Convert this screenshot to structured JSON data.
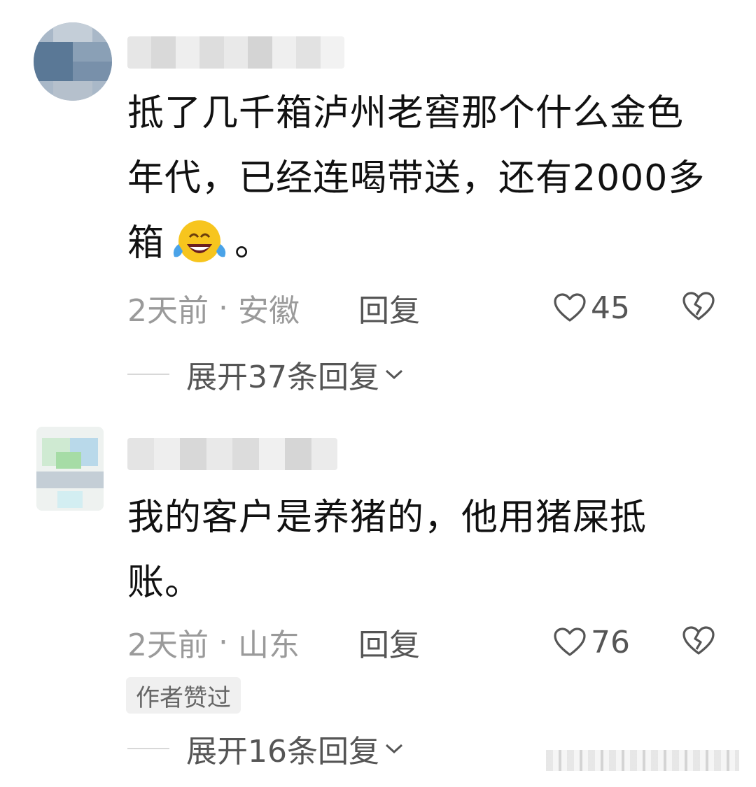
{
  "comments": [
    {
      "text_before_emoji": "抵了几千箱泸州老窖那个什么金色年代，已经连喝带送，还有2000多箱",
      "emoji": "laughing-tears-emoji",
      "text_after_emoji": "。",
      "time": "2天前",
      "location": "安徽",
      "reply_label": "回复",
      "likes": "45",
      "expand_label": "展开37条回复"
    },
    {
      "text": "我的客户是养猪的，他用猪屎抵账。",
      "time": "2天前",
      "location": "山东",
      "reply_label": "回复",
      "likes": "76",
      "badge": "作者赞过",
      "expand_label": "展开16条回复"
    }
  ],
  "separator": "·",
  "icons": {
    "like": "heart-outline-icon",
    "dislike": "broken-heart-icon",
    "expand": "chevron-down-icon"
  },
  "colors": {
    "text": "#111111",
    "meta": "#9a9a9a",
    "action": "#555555",
    "badge_bg": "#f0f0f0"
  }
}
